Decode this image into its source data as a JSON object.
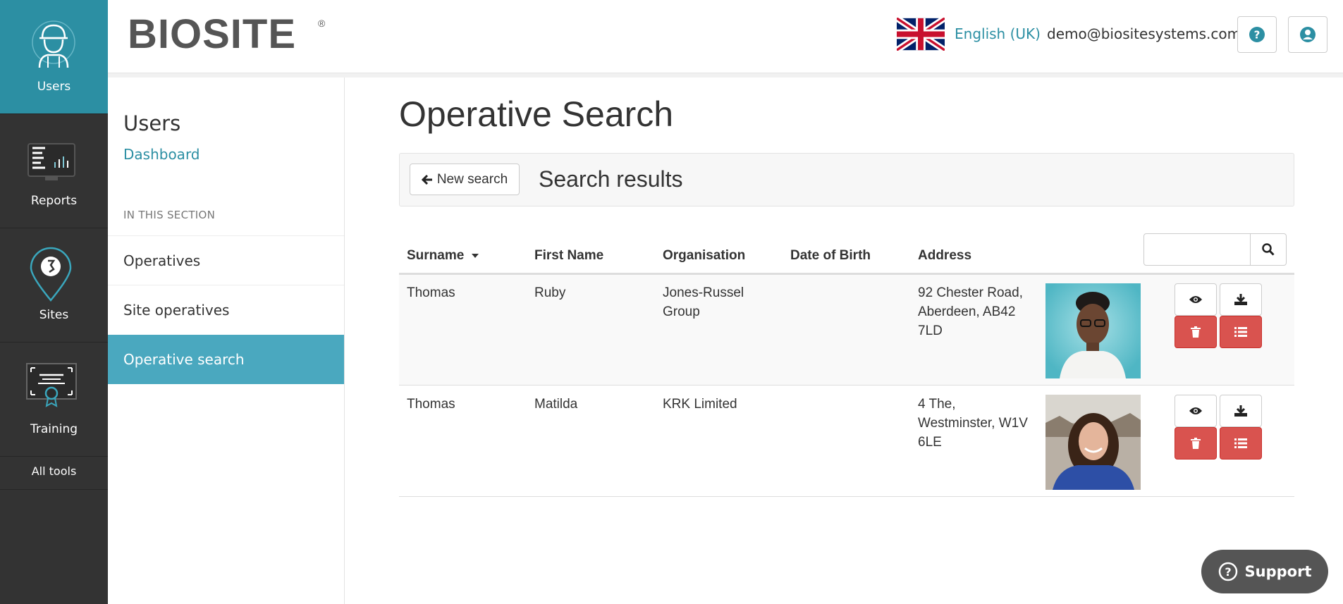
{
  "leftnav": {
    "items": [
      {
        "label": "Users",
        "icon": "worker-icon"
      },
      {
        "label": "Reports",
        "icon": "reports-icon"
      },
      {
        "label": "Sites",
        "icon": "location-pin-icon"
      },
      {
        "label": "Training",
        "icon": "certificate-icon"
      }
    ],
    "all_tools": "All tools"
  },
  "header": {
    "logo_text": "BIOSITE",
    "logo_mark": "®",
    "language": "English (UK)",
    "email": "demo@biositesystems.com"
  },
  "sidebar": {
    "title": "Users",
    "dashboard_link": "Dashboard",
    "section_label": "IN THIS SECTION",
    "items": [
      {
        "label": "Operatives"
      },
      {
        "label": "Site operatives"
      },
      {
        "label": "Operative search"
      }
    ]
  },
  "main": {
    "title": "Operative Search",
    "new_search_label": "New search",
    "results_title": "Search results",
    "search_placeholder": "",
    "columns": [
      "Surname",
      "First Name",
      "Organisation",
      "Date of Birth",
      "Address"
    ],
    "rows": [
      {
        "surname": "Thomas",
        "first_name": "Ruby",
        "organisation": [
          "Jones-Russel",
          "Group"
        ],
        "dob": "",
        "address": [
          "92 Chester Road,",
          "Aberdeen, AB42",
          "7LD"
        ]
      },
      {
        "surname": "Thomas",
        "first_name": "Matilda",
        "organisation": [
          "KRK Limited"
        ],
        "dob": "",
        "address": [
          "4 The,",
          "Westminster, W1V",
          "6LE"
        ]
      }
    ]
  },
  "support_label": "Support",
  "colors": {
    "accent": "#2c8fa3",
    "sidebar_active": "#4aa8bf",
    "nav_bg": "#333333",
    "danger": "#d9534f"
  }
}
